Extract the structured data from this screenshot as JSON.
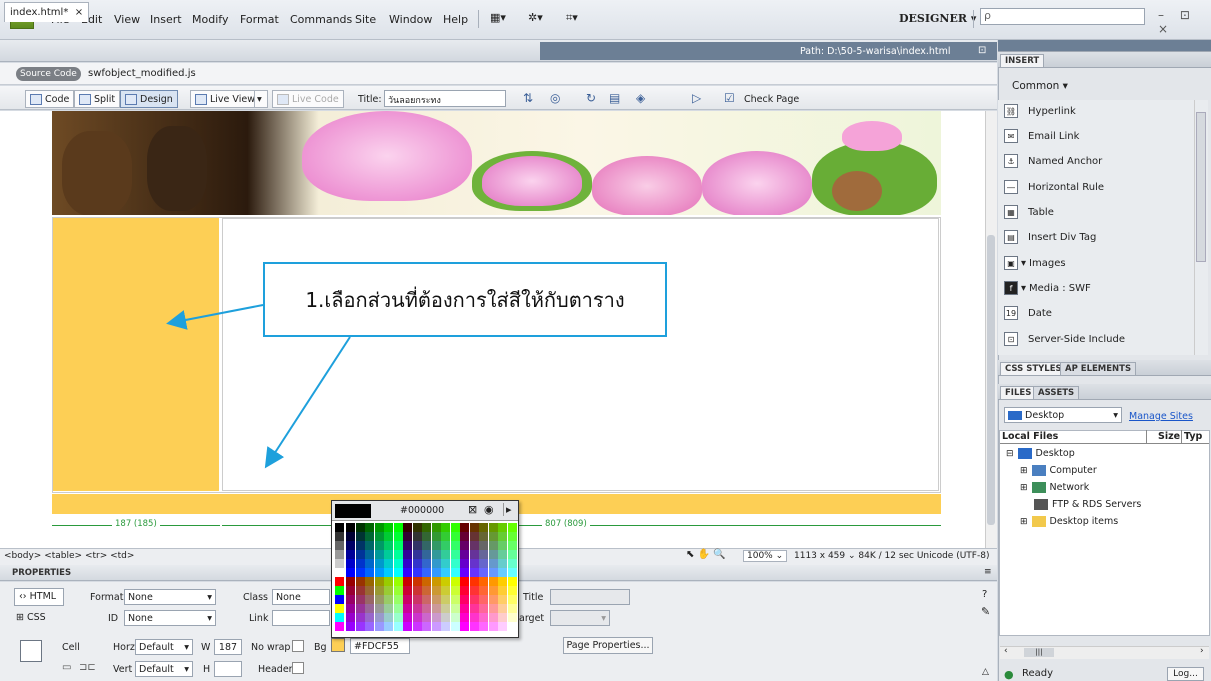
{
  "menubar": {
    "logo": "Dw",
    "items": [
      "File",
      "Edit",
      "View",
      "Insert",
      "Modify",
      "Format",
      "Commands",
      "Site",
      "Window",
      "Help"
    ],
    "workspace": "DESIGNER",
    "search_placeholder": "ρ",
    "window_controls": "– ⊡ ×"
  },
  "document": {
    "tab_label": "index.html*",
    "tab_close": "×",
    "path": "Path: D:\\50-5-warisa\\index.html",
    "source_code_label": "Source Code",
    "related_file": "swfobject_modified.js"
  },
  "doc_toolbar": {
    "code": "Code",
    "split": "Split",
    "design": "Design",
    "live_view": "Live View",
    "live_code": "Live Code",
    "title_label": "Title:",
    "title_value": "วันลอยกระทง",
    "check_page": "Check Page"
  },
  "callout": {
    "text": "1.เลือกส่วนที่ต้องการใส่สีให้กับตาราง"
  },
  "ruler": {
    "left_width": "187 (185)",
    "right_width": "807 (809)"
  },
  "color_picker": {
    "hex": "#000000",
    "preview_color": "#000000"
  },
  "status_bar": {
    "tag_path": "<body> <table> <tr> <td>",
    "zoom": "100%",
    "info": "1113 x 459 ⌄  84K / 12 sec  Unicode (UTF-8)"
  },
  "properties": {
    "title": "PROPERTIES",
    "html_btn": "HTML",
    "css_btn": "CSS",
    "format_label": "Format",
    "format_value": "None",
    "class_label": "Class",
    "class_value": "None",
    "id_label": "ID",
    "id_value": "None",
    "link_label": "Link",
    "title_label": "Title",
    "target_label": "arget",
    "cell_label": "Cell",
    "horz_label": "Horz",
    "horz_value": "Default",
    "vert_label": "Vert",
    "vert_value": "Default",
    "w_label": "W",
    "w_value": "187",
    "h_label": "H",
    "nowrap_label": "No wrap",
    "header_label": "Header",
    "bg_label": "Bg",
    "bg_value": "#FDCF55",
    "page_properties": "Page Properties..."
  },
  "right_panel": {
    "insert_tab": "INSERT",
    "category": "Common",
    "insert_items": [
      "Hyperlink",
      "Email Link",
      "Named Anchor",
      "Horizontal Rule",
      "Table",
      "Insert Div Tag",
      "Images",
      "Media : SWF",
      "Date",
      "Server-Side Include"
    ],
    "css_tabs": [
      "CSS STYLES",
      "AP ELEMENTS"
    ],
    "files_tabs": [
      "FILES",
      "ASSETS"
    ],
    "site_select": "Desktop",
    "manage_sites": "Manage Sites",
    "local_files": "Local Files",
    "size_col": "Size",
    "type_col": "Typ",
    "tree": [
      "Desktop",
      "Computer",
      "Network",
      "FTP & RDS Servers",
      "Desktop items"
    ],
    "status": "Ready",
    "log_btn": "Log..."
  },
  "colors": {
    "accent_yellow": "#FDCF55",
    "callout_border": "#1EA0DC",
    "ruler_green": "#2A9A3C"
  }
}
